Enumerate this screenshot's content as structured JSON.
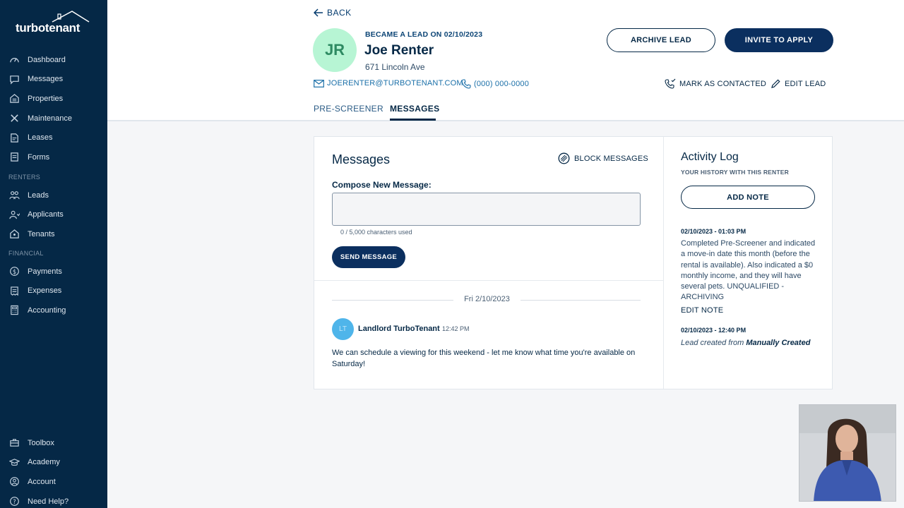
{
  "brand": {
    "logo_text": "turbotenant"
  },
  "sidebar": {
    "main_items": [
      {
        "label": "Dashboard",
        "icon": "gauge-icon"
      },
      {
        "label": "Messages",
        "icon": "chat-icon"
      },
      {
        "label": "Properties",
        "icon": "building-icon"
      },
      {
        "label": "Maintenance",
        "icon": "wrench-icon"
      },
      {
        "label": "Leases",
        "icon": "document-icon"
      },
      {
        "label": "Forms",
        "icon": "form-icon"
      }
    ],
    "renters_section": "RENTERS",
    "renters_items": [
      {
        "label": "Leads",
        "icon": "people-icon"
      },
      {
        "label": "Applicants",
        "icon": "applicant-icon"
      },
      {
        "label": "Tenants",
        "icon": "house-person-icon"
      }
    ],
    "financial_section": "FINANCIAL",
    "financial_items": [
      {
        "label": "Payments",
        "icon": "dollar-icon"
      },
      {
        "label": "Expenses",
        "icon": "receipt-icon"
      },
      {
        "label": "Accounting",
        "icon": "calculator-icon"
      }
    ],
    "bottom_items": [
      {
        "label": "Toolbox",
        "icon": "toolbox-icon"
      },
      {
        "label": "Academy",
        "icon": "graduation-icon"
      },
      {
        "label": "Account",
        "icon": "user-icon"
      },
      {
        "label": "Need Help?",
        "icon": "help-icon"
      }
    ]
  },
  "header": {
    "back_label": "BACK",
    "avatar_initials": "JR",
    "lead_date": "BECAME A LEAD ON 02/10/2023",
    "name": "Joe Renter",
    "address": "671 Lincoln Ave",
    "email": "JOERENTER@TURBOTENANT.COM",
    "phone": "(000) 000-0000",
    "archive_label": "ARCHIVE LEAD",
    "invite_label": "INVITE TO APPLY",
    "mark_contacted_label": "MARK AS CONTACTED",
    "edit_lead_label": "EDIT LEAD",
    "tabs": [
      {
        "label": "PRE-SCREENER",
        "active": false
      },
      {
        "label": "MESSAGES",
        "active": true
      }
    ]
  },
  "messages": {
    "title": "Messages",
    "block_label": "BLOCK MESSAGES",
    "compose_label": "Compose New Message:",
    "compose_value": "",
    "char_count": "0 / 5,000 characters used",
    "send_label": "SEND MESSAGE",
    "date_separator": "Fri 2/10/2023",
    "thread": [
      {
        "avatar_initials": "LT",
        "sender": "Landlord TurboTenant",
        "time": "12:42 PM",
        "body": "We can schedule a viewing for this weekend - let me know what time you're available on Saturday!"
      }
    ]
  },
  "activity_log": {
    "title": "Activity Log",
    "subtitle": "YOUR HISTORY WITH THIS RENTER",
    "add_note_label": "ADD NOTE",
    "entries": [
      {
        "timestamp": "02/10/2023 - 01:03 PM",
        "text": "Completed Pre-Screener and indicated a move-in date this month (before the rental is available). Also indicated a $0 monthly income, and they will have several pets. UNQUALIFIED - ARCHIVING",
        "edit_label": "EDIT NOTE"
      },
      {
        "timestamp": "02/10/2023 - 12:40 PM",
        "text_prefix": "Lead created from",
        "text_bold": "Manually Created"
      }
    ]
  },
  "colors": {
    "sidebar_bg": "#052846",
    "primary_navy": "#0b2f5f",
    "link_blue": "#1a6fa8",
    "avatar_green": "#b7f5d4",
    "avatar_blue": "#4fb5ea"
  }
}
